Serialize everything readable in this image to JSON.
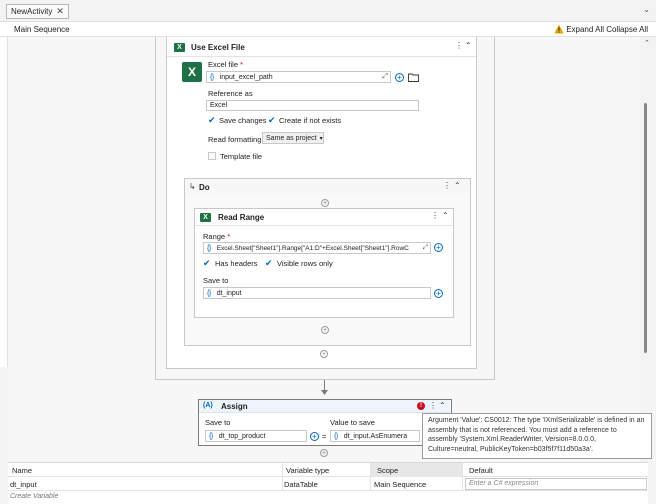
{
  "tab": {
    "label": "NewActivity",
    "close": "✕"
  },
  "header": {
    "breadcrumb": "Main Sequence",
    "expand_all": "Expand All",
    "collapse_all": "Collapse All"
  },
  "use_excel": {
    "title": "Use Excel File",
    "excel_file_label": "Excel file",
    "excel_file_value": "input_excel_path",
    "reference_label": "Reference as",
    "reference_value": "Excel",
    "save_changes": "Save changes",
    "create_if_not_exists": "Create if not exists",
    "read_formatting_label": "Read formatting",
    "read_formatting_value": "Same as project",
    "template_file": "Template file"
  },
  "do_block": {
    "title": "Do"
  },
  "read_range": {
    "title": "Read Range",
    "range_label": "Range",
    "range_value": "Excel.Sheet[\"Sheet1\"].Range[\"A1:D\"+Excel.Sheet[\"Sheet1\"].RowC",
    "has_headers": "Has headers",
    "visible_rows_only": "Visible rows only",
    "save_to_label": "Save to",
    "save_to_value": "dt_input"
  },
  "assign": {
    "title": "Assign",
    "save_to_label": "Save to",
    "save_to_value": "dt_top_product",
    "value_label": "Value to save",
    "value_value": "dt_input.AsEnumera",
    "equals": "="
  },
  "tooltip": {
    "text": "Argument 'Value': CS0012: The type 'IXmlSerializable' is defined in an assembly that is not referenced. You must add a reference to assembly 'System.Xml.ReaderWriter, Version=8.0.0.0, Culture=neutral, PublicKeyToken=b03f5f7f11d50a3a'."
  },
  "variables": {
    "columns": [
      "Name",
      "Variable type",
      "Scope",
      "Default"
    ],
    "rows": [
      {
        "name": "dt_input",
        "type": "DataTable",
        "scope": "Main Sequence",
        "default_placeholder": "Enter a C# expression"
      }
    ],
    "create_label": "Create Variable"
  },
  "colors": {
    "accent": "#0067c0",
    "error": "#c50f1f",
    "excel_green": "#1e7145",
    "warning": "#e8a400"
  }
}
